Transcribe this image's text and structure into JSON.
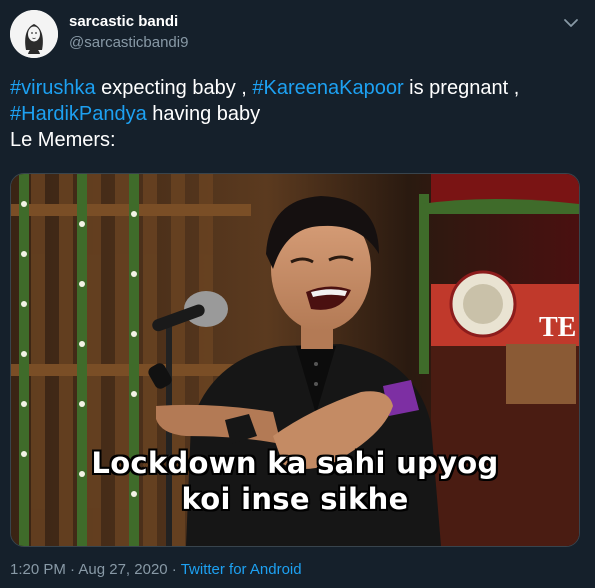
{
  "author": {
    "display_name": "sarcastic bandi",
    "handle": "@sarcasticbandi9",
    "avatar_icon": "avatar-girl-sketch-icon"
  },
  "menu_icon": "chevron-down-icon",
  "tweet": {
    "hashtag1": "#virushka",
    "text1": " expecting baby , ",
    "hashtag2": "#KareenaKapoor",
    "text2": " is pregnant ,",
    "hashtag3": "#HardikPandya",
    "text3": " having baby",
    "line3": "Le Memers:"
  },
  "media": {
    "caption_line1": "Lockdown ka sahi upyog",
    "caption_line2": "koi inse sikhe",
    "banner_text": "TE"
  },
  "meta": {
    "time": "1:20 PM",
    "separator": " · ",
    "date": "Aug 27, 2020",
    "source": "Twitter for Android"
  },
  "colors": {
    "background": "#15202b",
    "accent": "#1da1f2",
    "muted": "#8899a6"
  }
}
